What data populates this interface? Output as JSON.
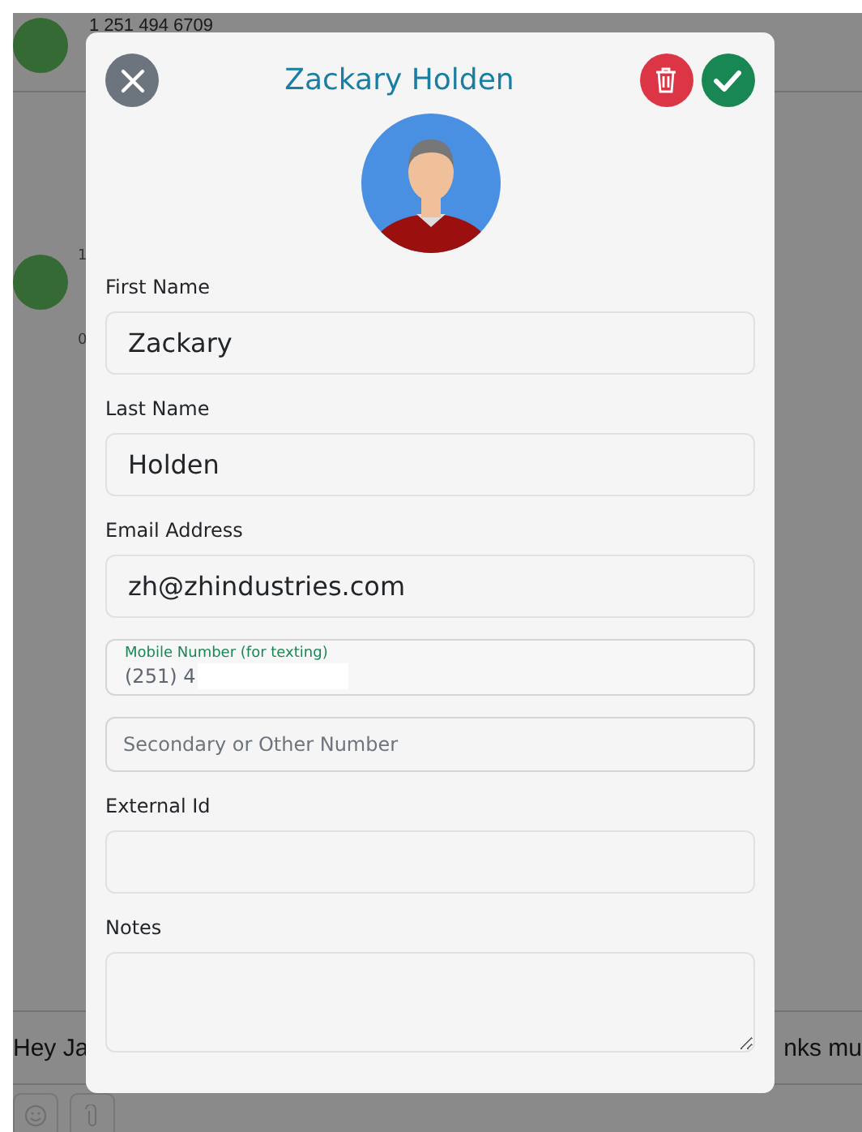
{
  "background": {
    "top_contact": {
      "phone": "1 251 494 6709"
    },
    "second_contact": {
      "line_1": "1",
      "line_2": "0"
    },
    "message": {
      "left": "Hey Ja",
      "right": "nks mu"
    }
  },
  "modal": {
    "title": "Zackary Holden",
    "fields": [
      {
        "kind": "labeled",
        "label": "First Name",
        "value": "Zackary"
      },
      {
        "kind": "labeled",
        "label": "Last Name",
        "value": "Holden"
      },
      {
        "kind": "labeled",
        "label": "Email Address",
        "value": "zh@zhindustries.com"
      },
      {
        "kind": "floating",
        "label": "Mobile Number (for texting)",
        "value": "(251) 4",
        "redacted": true
      },
      {
        "kind": "bare",
        "placeholder": "Secondary or Other Number"
      },
      {
        "kind": "labeled",
        "label": "External Id"
      },
      {
        "kind": "textarea",
        "label": "Notes"
      }
    ]
  }
}
